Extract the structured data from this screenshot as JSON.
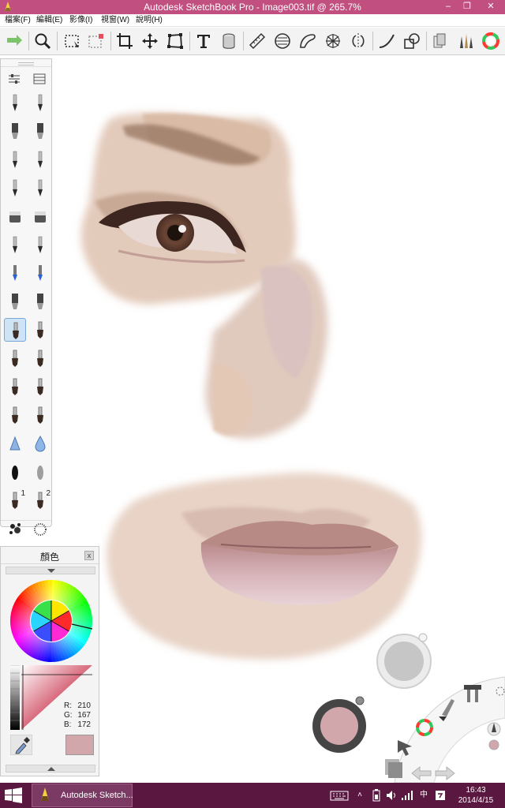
{
  "window": {
    "title": "Autodesk SketchBook Pro - Image003.tif @ 265.7%",
    "minimize_glyph": "–",
    "maximize_glyph": "❐",
    "close_glyph": "✕"
  },
  "menu": {
    "items": [
      {
        "label": "檔案(F)"
      },
      {
        "label": "編輯(E)"
      },
      {
        "label": "影像(I)"
      },
      {
        "label": "視窗(W)"
      },
      {
        "label": "說明(H)"
      }
    ]
  },
  "toolbar": {
    "tools": [
      "redo-arrow",
      "zoom",
      "selection",
      "transform-select",
      "crop",
      "move",
      "distort",
      "text",
      "layer-fill",
      "ruler",
      "ellipse",
      "french-curve",
      "perspective",
      "symmetry",
      "stroke",
      "shapes",
      "copic-library",
      "brush-library",
      "color-wheel"
    ]
  },
  "brush_palette": {
    "selected_index": 16,
    "brushes": [
      {
        "icon": "pencil-icon"
      },
      {
        "icon": "airbrush-icon"
      },
      {
        "icon": "marker-icon"
      },
      {
        "icon": "chisel-marker-icon"
      },
      {
        "icon": "ballpoint-icon"
      },
      {
        "icon": "fine-pen-icon"
      },
      {
        "icon": "ink-pen-icon"
      },
      {
        "icon": "technical-pen-icon"
      },
      {
        "icon": "eraser-hard-icon"
      },
      {
        "icon": "eraser-soft-icon"
      },
      {
        "icon": "felt-pen-icon"
      },
      {
        "icon": "fineliner-icon"
      },
      {
        "icon": "blue-pencil-icon"
      },
      {
        "icon": "blue-pen-icon"
      },
      {
        "icon": "paint-pen-icon"
      },
      {
        "icon": "highlighter-icon"
      },
      {
        "icon": "round-brush-icon"
      },
      {
        "icon": "flat-brush-icon"
      },
      {
        "icon": "oil-brush-icon"
      },
      {
        "icon": "fan-brush-icon"
      },
      {
        "icon": "bristle-brush-icon"
      },
      {
        "icon": "dry-brush-icon"
      },
      {
        "icon": "wide-brush-icon"
      },
      {
        "icon": "blender-brush-icon"
      },
      {
        "icon": "smear-icon"
      },
      {
        "icon": "water-drop-icon"
      },
      {
        "icon": "hard-dot-icon"
      },
      {
        "icon": "soft-dot-icon"
      },
      {
        "icon": "custom-brush-1-icon",
        "number": "1"
      },
      {
        "icon": "custom-brush-2-icon",
        "number": "2"
      },
      {
        "icon": "texture-splatter-icon"
      },
      {
        "icon": "scatter-dots-icon"
      },
      {
        "icon": "ink-splat-icon"
      },
      {
        "icon": "ink-blots-icon"
      }
    ]
  },
  "color_panel": {
    "title": "顏色",
    "close_label": "x",
    "rgb": [
      {
        "key": "R:",
        "value": "210"
      },
      {
        "key": "G:",
        "value": "167"
      },
      {
        "key": "B:",
        "value": "172"
      }
    ],
    "current_color": "#d2a7ac"
  },
  "taskbar": {
    "app_label": "Autodesk Sketch...",
    "time": "16:43",
    "date": "2014/4/15",
    "ime_label": "中",
    "tray_arrow": "˄"
  },
  "colors": {
    "titlebar": "#c14f7f",
    "taskbar": "#5a1740",
    "skin_light": "#e6cdbf",
    "skin_mid": "#d8b9a8",
    "lip": "#c99ea0"
  }
}
